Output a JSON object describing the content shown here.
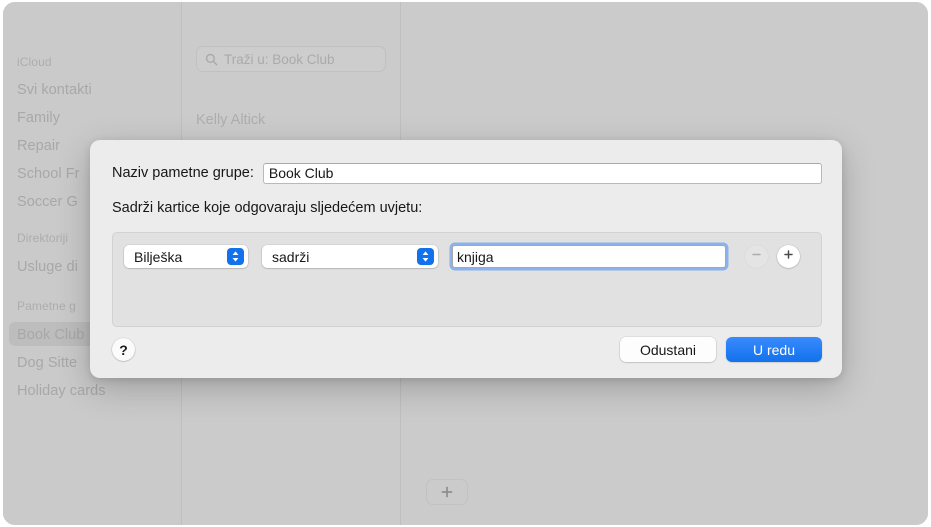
{
  "window": {
    "traffic_lights": [
      {
        "name": "close",
        "color": "#d9d9d9"
      },
      {
        "name": "minimize",
        "color": "#fdbc40"
      },
      {
        "name": "maximize",
        "color": "#34c749"
      }
    ]
  },
  "sidebar": {
    "sections": [
      {
        "header": "iCloud",
        "items": [
          "Svi kontakti",
          "Family",
          "Repair",
          "School Fr",
          "Soccer G"
        ]
      },
      {
        "header": "Direktoriji",
        "items": [
          "Usluge di"
        ]
      },
      {
        "header": "Pametne g",
        "items": [
          "Book Club",
          "Dog Sitte",
          "Holiday cards"
        ]
      }
    ],
    "selected_item": "Book Club"
  },
  "middle_column": {
    "search": {
      "placeholder": "Traži u: Book Club",
      "value": "",
      "icon": "search-icon"
    },
    "contacts": [
      "Kelly Altick"
    ]
  },
  "detail_pane": {
    "add_button_icon": "plus-icon"
  },
  "sheet": {
    "name_label": "Naziv pametne grupe:",
    "name_value": "Book Club",
    "name_placeholder": "",
    "condition_label": "Sadrži kartice koje odgovaraju sljedećem uvjetu:",
    "condition_rows": [
      {
        "field": "Bilješka",
        "operator": "sadrži",
        "value": "knjiga",
        "value_placeholder": "",
        "remove_label": "−",
        "add_label": "+"
      }
    ],
    "help_label": "?",
    "cancel_label": "Odustani",
    "ok_label": "U redu"
  },
  "colors": {
    "accent": "#1272ec",
    "sheet_bg": "#ececed",
    "window_bg": "#c9c9c9",
    "condition_box": "#e1e1e2"
  }
}
